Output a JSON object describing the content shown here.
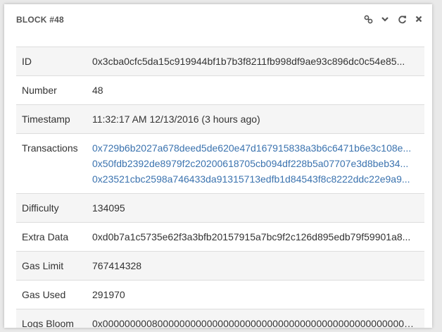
{
  "panel": {
    "title": "BLOCK #48",
    "tools": [
      "link-icon",
      "chevron-down-icon",
      "refresh-icon",
      "close-icon"
    ]
  },
  "rows": {
    "id": {
      "key": "ID",
      "value": "0x3cba0cfc5da15c919944bf1b7b3f8211fb998df9ae93c896dc0c54e85..."
    },
    "number": {
      "key": "Number",
      "value": "48"
    },
    "timestamp": {
      "key": "Timestamp",
      "value": "11:32:17 AM 12/13/2016 (3 hours ago)"
    },
    "transactions": {
      "key": "Transactions",
      "values": [
        "0x729b6b2027a678deed5de620e47d167915838a3b6c6471b6e3c108e...",
        "0x50fdb2392de8979f2c20200618705cb094df228b5a07707e3d8beb34...",
        "0x23521cbc2598a746433da91315713edfb1d84543f8c8222ddc22e9a9..."
      ]
    },
    "difficulty": {
      "key": "Difficulty",
      "value": "134095"
    },
    "extra_data": {
      "key": "Extra Data",
      "value": "0xd0b7a1c5735e62f3a3bfb20157915a7bc9f2c126d895edb79f59901a8..."
    },
    "gas_limit": {
      "key": "Gas Limit",
      "value": "767414328"
    },
    "gas_used": {
      "key": "Gas Used",
      "value": "291970"
    },
    "logs_bloom": {
      "key": "Logs Bloom",
      "value": "0x000000000800000000000000000000000000000000000000000000000..."
    }
  },
  "colors": {
    "link": "#3b73af",
    "row_alt": "#f5f5f5",
    "border": "#dddddd"
  }
}
